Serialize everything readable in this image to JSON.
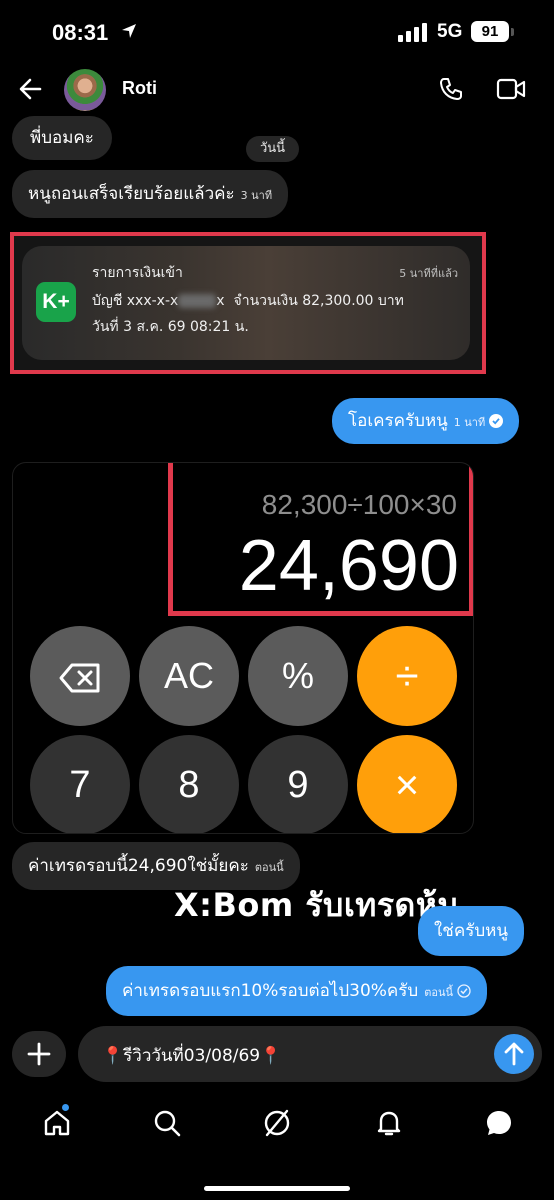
{
  "status_bar": {
    "time": "08:31",
    "network": "5G",
    "battery": "91"
  },
  "header": {
    "contact_name": "Roti"
  },
  "messages": {
    "m1": {
      "text": "พี่บอมคะ"
    },
    "today_label": "วันนี้",
    "m2": {
      "text": "หนูถอนเสร็จเรียบร้อยแล้วค่ะ",
      "time": "3 นาที"
    },
    "m3": {
      "text": "โอเครครับหนู",
      "time": "1 นาที"
    },
    "m4": {
      "text": "ค่าเทรดรอบนี้24,690ใช่มั้ยคะ",
      "time": "ตอนนี้"
    },
    "m5": {
      "text": "ใช่ครับหนู"
    },
    "m6": {
      "text": "ค่าเทรดรอบแรก10%รอบต่อไป30%ครับ",
      "time": "ตอนนี้"
    }
  },
  "bank_notification": {
    "app_icon_text": "K+",
    "title": "รายการเงินเข้า",
    "time_ago": "5 นาทีที่แล้ว",
    "account_prefix": "บัญชี xxx-x-x",
    "account_suffix": "x",
    "amount_text": "จำนวนเงิน 82,300.00 บาท",
    "date_text": "วันที่ 3 ส.ค. 69 08:21 น."
  },
  "calculator": {
    "expression": "82,300÷100×30",
    "result": "24,690",
    "keys": {
      "ac": "AC",
      "percent": "%",
      "divide": "÷",
      "seven": "7",
      "eight": "8",
      "nine": "9",
      "multiply": "×"
    }
  },
  "watermark": "X:Bom รับเทรดหุ้น",
  "composer": {
    "text": "📍รีวิววันที่03/08/69📍"
  },
  "colors": {
    "outgoing_bubble": "#3897f0",
    "incoming_bubble": "#262626",
    "highlight_border": "#e0394c",
    "calc_operator": "#ff9f0a",
    "kbank_green": "#19a34a"
  },
  "icons": [
    "back-arrow-icon",
    "phone-icon",
    "video-call-icon",
    "plus-icon",
    "send-arrow-icon",
    "home-icon",
    "search-icon",
    "explore-icon",
    "bell-icon",
    "messages-icon",
    "backspace-icon"
  ]
}
